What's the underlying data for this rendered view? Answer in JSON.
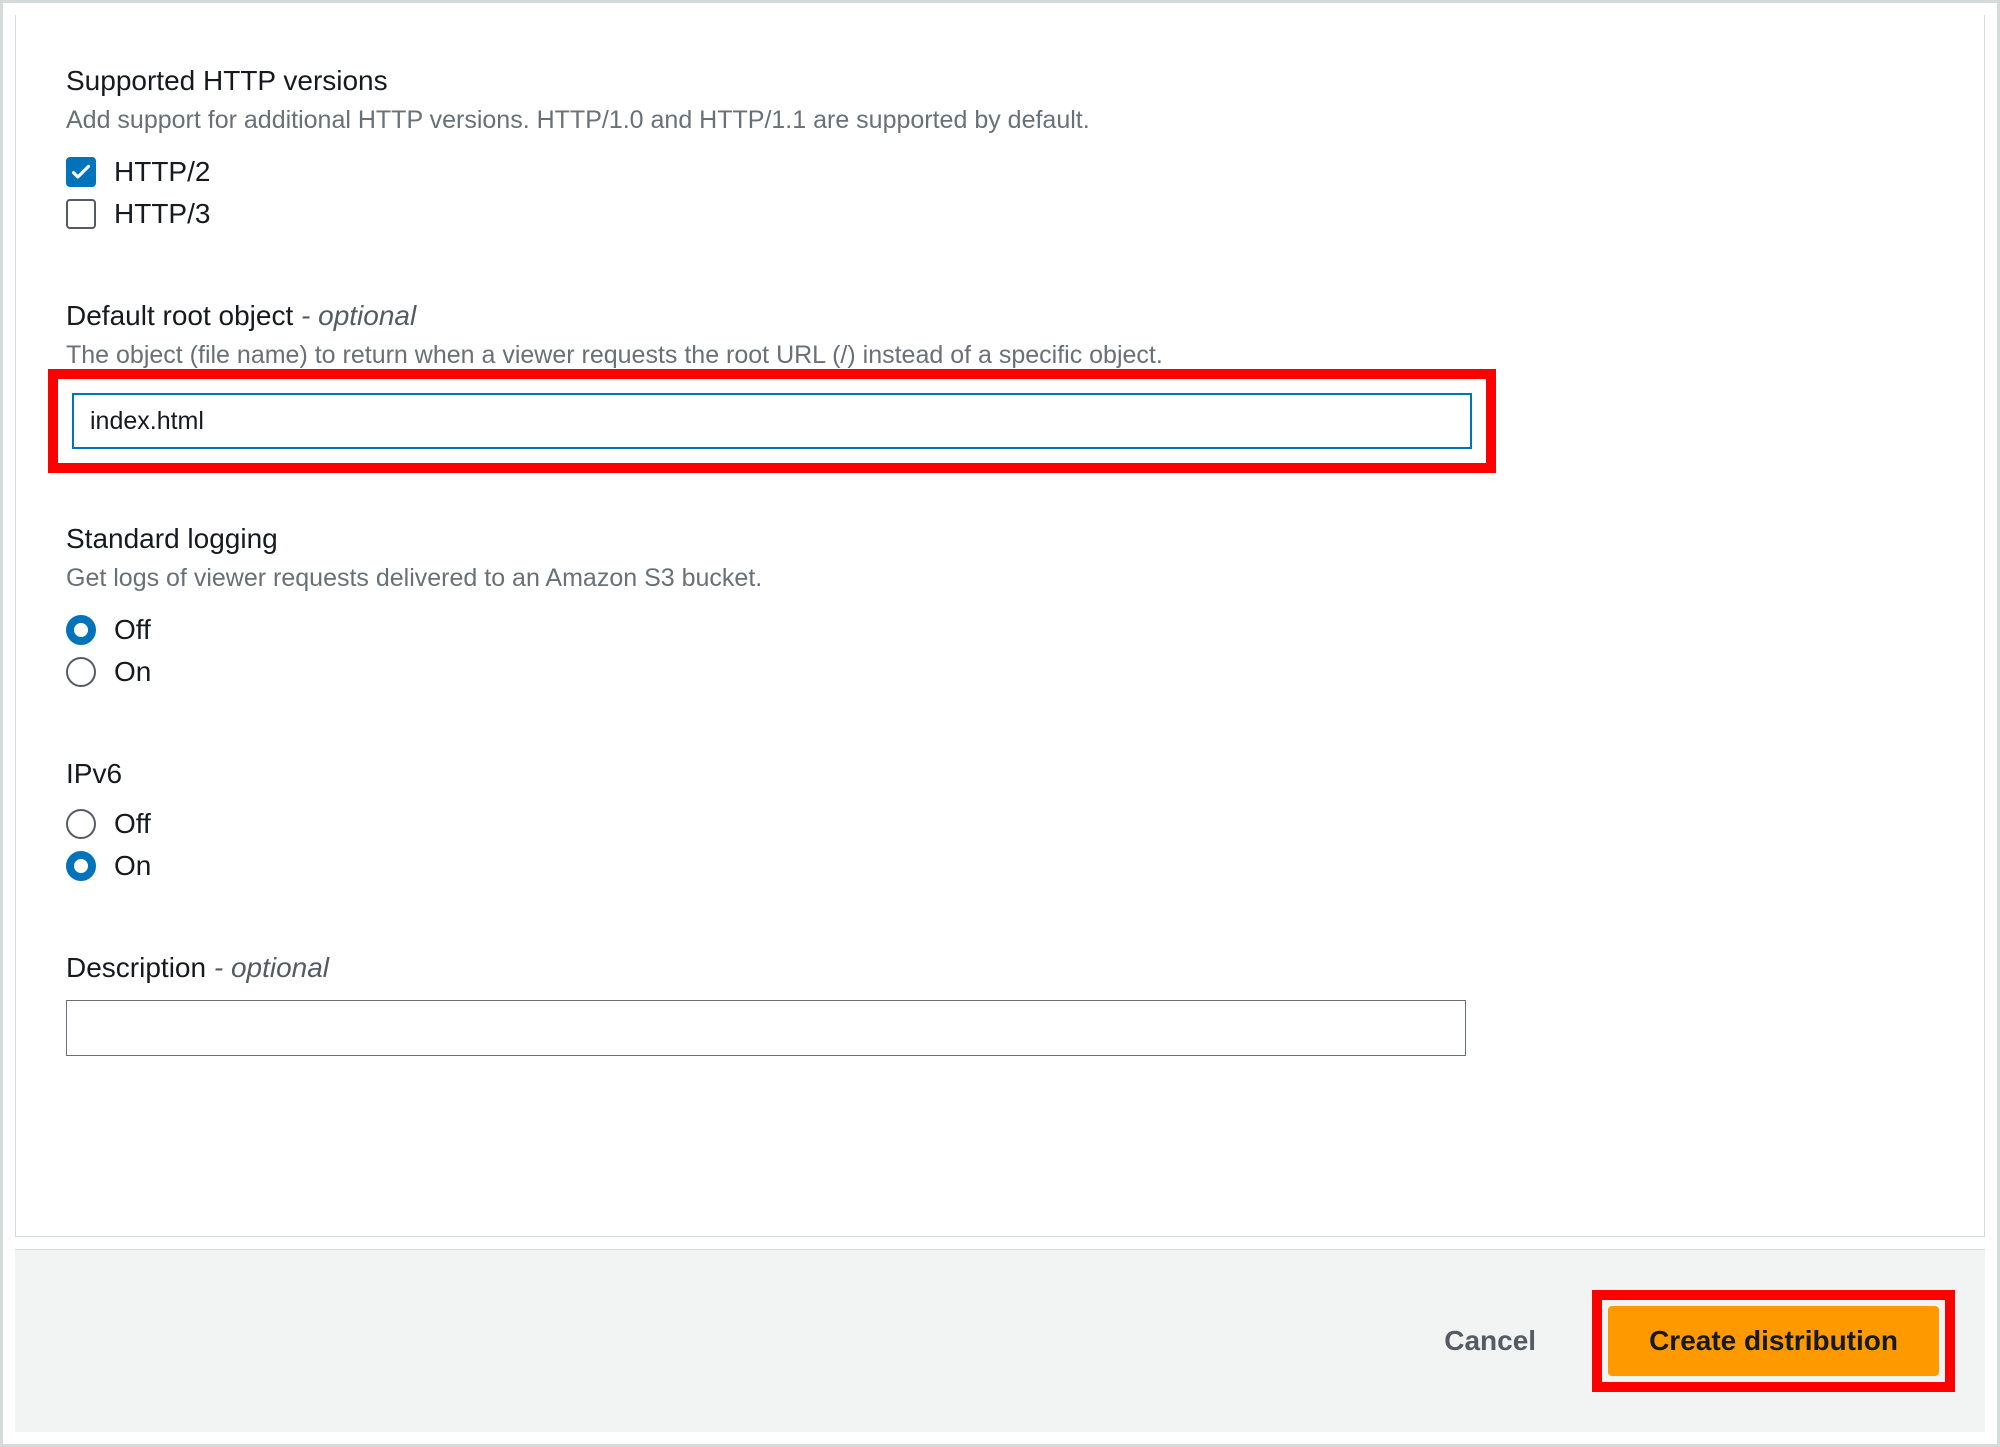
{
  "httpVersions": {
    "title": "Supported HTTP versions",
    "desc": "Add support for additional HTTP versions. HTTP/1.0 and HTTP/1.1 are supported by default.",
    "option1": "HTTP/2",
    "option2": "HTTP/3"
  },
  "defaultRoot": {
    "title": "Default root object",
    "optional": " - optional",
    "desc": "The object (file name) to return when a viewer requests the root URL (/) instead of a specific object.",
    "value": "index.html"
  },
  "logging": {
    "title": "Standard logging",
    "desc": "Get logs of viewer requests delivered to an Amazon S3 bucket.",
    "off": "Off",
    "on": "On"
  },
  "ipv6": {
    "title": "IPv6",
    "off": "Off",
    "on": "On"
  },
  "description": {
    "title": "Description",
    "optional": " - optional",
    "value": ""
  },
  "footer": {
    "cancel": "Cancel",
    "create": "Create distribution"
  }
}
